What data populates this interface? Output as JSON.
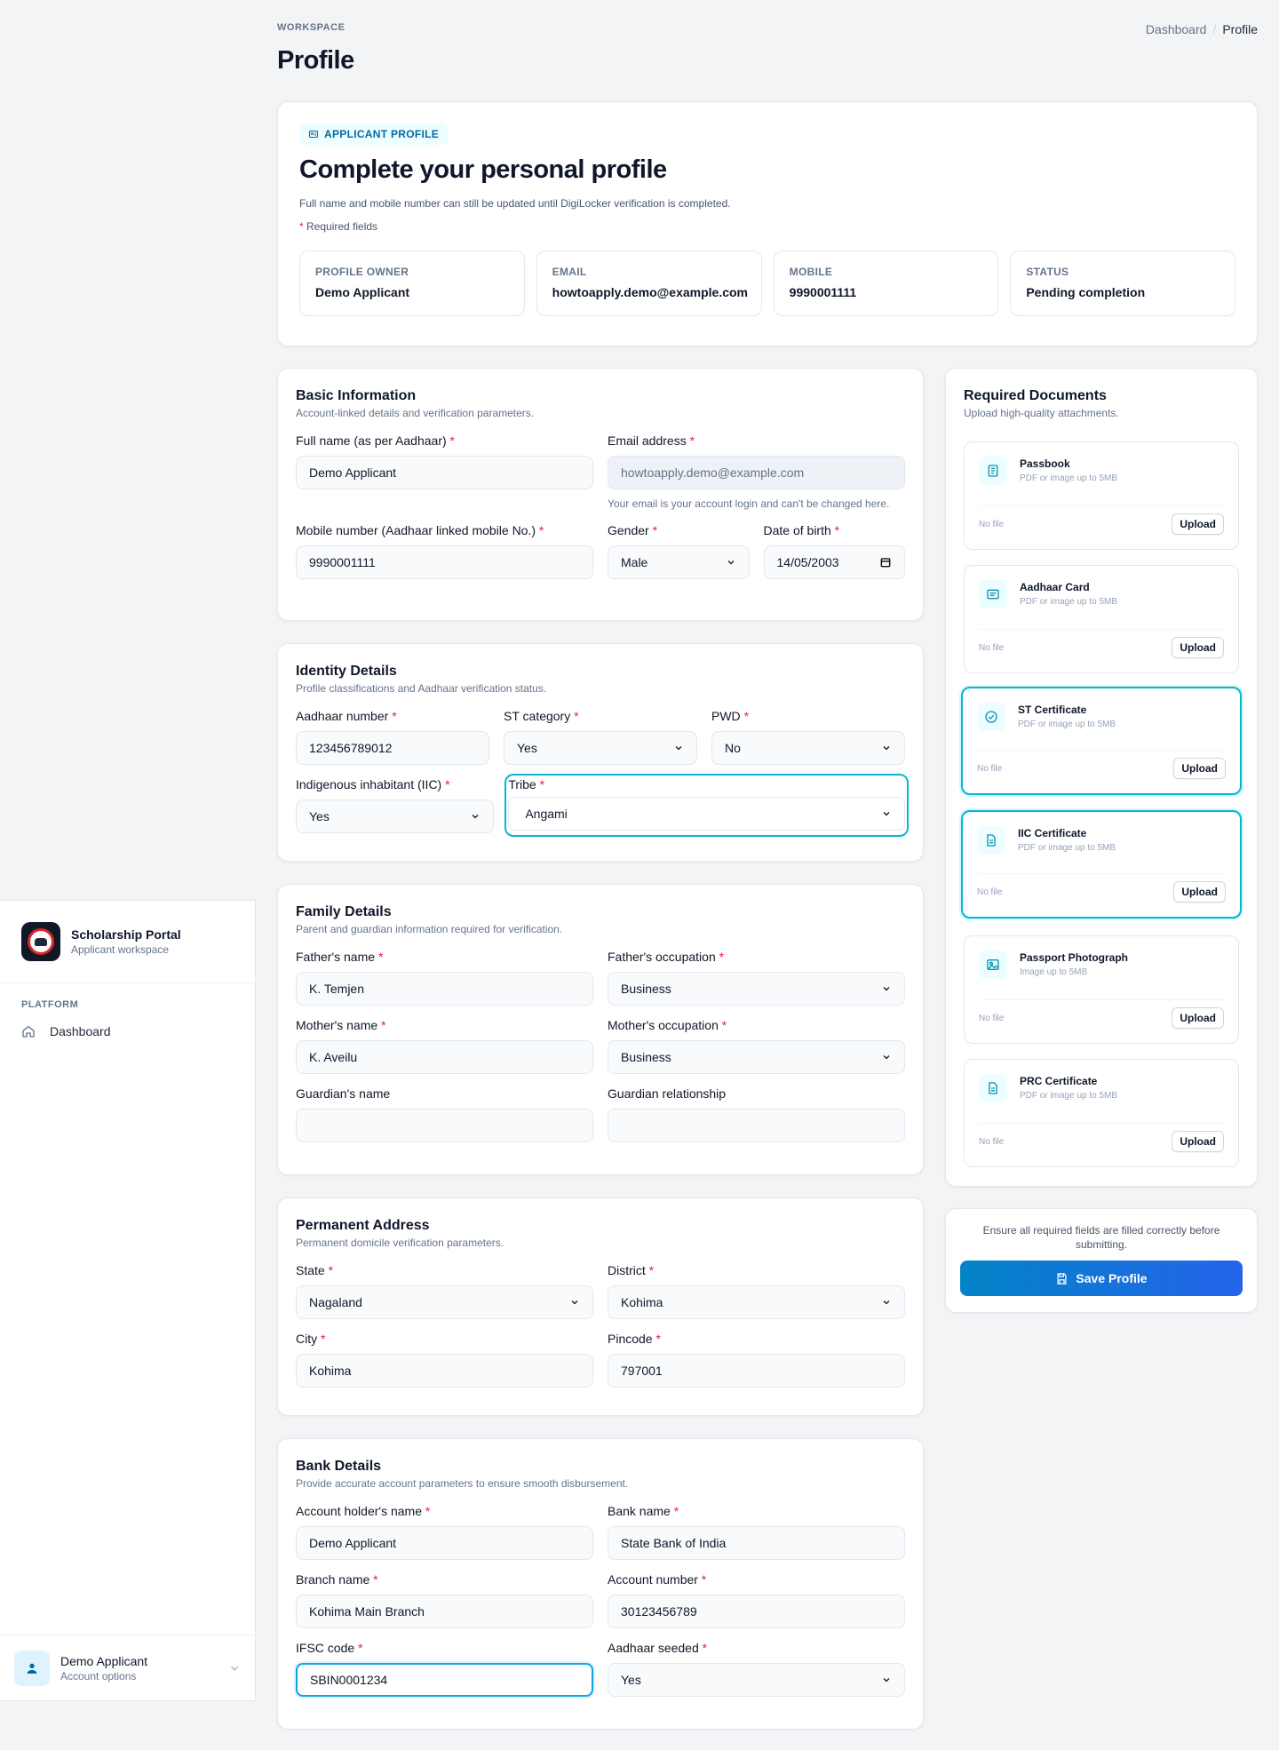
{
  "app": {
    "name": "Scholarship Portal",
    "subtitle": "Applicant workspace"
  },
  "sidebar": {
    "section": "PLATFORM",
    "items": [
      {
        "label": "Dashboard",
        "icon": "home-icon"
      }
    ],
    "user": {
      "name": "Demo Applicant",
      "subtitle": "Account options"
    }
  },
  "header": {
    "eyebrow": "WORKSPACE",
    "title": "Profile",
    "breadcrumb": [
      "Dashboard",
      "Profile"
    ]
  },
  "hero": {
    "pill": "APPLICANT PROFILE",
    "title": "Complete your personal profile",
    "note": "Full name and mobile number can still be updated until DigiLocker verification is completed.",
    "required_marker": "*",
    "required_text": "Required fields",
    "stats": [
      {
        "label": "PROFILE OWNER",
        "value": "Demo Applicant"
      },
      {
        "label": "EMAIL",
        "value": "howtoapply.demo@example.com"
      },
      {
        "label": "MOBILE",
        "value": "9990001111"
      },
      {
        "label": "STATUS",
        "value": "Pending completion"
      }
    ]
  },
  "basic": {
    "title": "Basic Information",
    "subtitle": "Account-linked details and verification parameters.",
    "full_name": {
      "label": "Full name (as per Aadhaar)",
      "value": "Demo Applicant"
    },
    "email": {
      "label": "Email address",
      "value": "howtoapply.demo@example.com",
      "hint": "Your email is your account login and can't be changed here."
    },
    "mobile": {
      "label": "Mobile number (Aadhaar linked mobile No.)",
      "value": "9990001111"
    },
    "gender": {
      "label": "Gender",
      "value": "Male"
    },
    "dob": {
      "label": "Date of birth",
      "value": "14/05/2003"
    }
  },
  "identity": {
    "title": "Identity Details",
    "subtitle": "Profile classifications and Aadhaar verification status.",
    "aadhaar": {
      "label": "Aadhaar number",
      "value": "123456789012"
    },
    "st": {
      "label": "ST category",
      "value": "Yes"
    },
    "pwd": {
      "label": "PWD",
      "value": "No"
    },
    "iic": {
      "label": "Indigenous inhabitant (IIC)",
      "value": "Yes"
    },
    "tribe": {
      "label": "Tribe",
      "value": "Angami"
    }
  },
  "family": {
    "title": "Family Details",
    "subtitle": "Parent and guardian information required for verification.",
    "father_name": {
      "label": "Father's name",
      "value": "K. Temjen"
    },
    "father_occ": {
      "label": "Father's occupation",
      "value": "Business"
    },
    "mother_name": {
      "label": "Mother's name",
      "value": "K. Aveilu"
    },
    "mother_occ": {
      "label": "Mother's occupation",
      "value": "Business"
    },
    "guardian_name": {
      "label": "Guardian's name",
      "value": ""
    },
    "guardian_rel": {
      "label": "Guardian relationship",
      "value": ""
    }
  },
  "address": {
    "title": "Permanent Address",
    "subtitle": "Permanent domicile verification parameters.",
    "state": {
      "label": "State",
      "value": "Nagaland"
    },
    "district": {
      "label": "District",
      "value": "Kohima"
    },
    "city": {
      "label": "City",
      "value": "Kohima"
    },
    "pincode": {
      "label": "Pincode",
      "value": "797001"
    }
  },
  "bank": {
    "title": "Bank Details",
    "subtitle": "Provide accurate account parameters to ensure smooth disbursement.",
    "holder": {
      "label": "Account holder's name",
      "value": "Demo Applicant"
    },
    "bank_name": {
      "label": "Bank name",
      "value": "State Bank of India"
    },
    "branch": {
      "label": "Branch name",
      "value": "Kohima Main Branch"
    },
    "account": {
      "label": "Account number",
      "value": "30123456789"
    },
    "ifsc": {
      "label": "IFSC code",
      "value": "SBIN0001234"
    },
    "seeded": {
      "label": "Aadhaar seeded",
      "value": "Yes"
    }
  },
  "documents": {
    "title": "Required Documents",
    "subtitle": "Upload high-quality attachments.",
    "no_file": "No file",
    "upload_label": "Upload",
    "items": [
      {
        "name": "Passbook",
        "sub": "PDF or image up to 5MB",
        "icon": "passbook-icon"
      },
      {
        "name": "Aadhaar Card",
        "sub": "PDF or image up to 5MB",
        "icon": "id-card-icon"
      },
      {
        "name": "ST Certificate",
        "sub": "PDF or image up to 5MB",
        "icon": "check-circle-icon"
      },
      {
        "name": "IIC Certificate",
        "sub": "PDF or image up to 5MB",
        "icon": "document-icon"
      },
      {
        "name": "Passport Photograph",
        "sub": "Image up to 5MB",
        "icon": "image-icon"
      },
      {
        "name": "PRC Certificate",
        "sub": "PDF or image up to 5MB",
        "icon": "document-icon"
      }
    ]
  },
  "save": {
    "note": "Ensure all required fields are filled correctly before submitting.",
    "button": "Save Profile"
  },
  "colors": {
    "accent": "#0ea5e9",
    "required": "#e11d48",
    "button_start": "#0284c7",
    "button_end": "#2563eb"
  }
}
